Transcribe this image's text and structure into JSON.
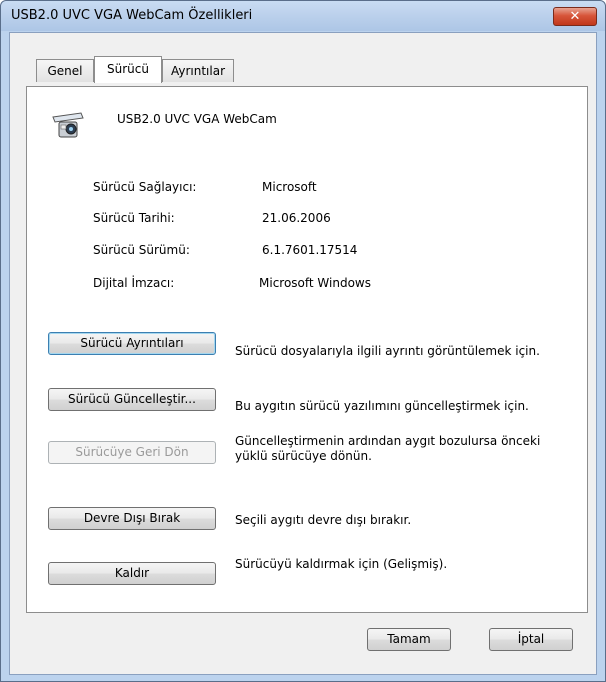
{
  "window": {
    "title": "USB2.0 UVC VGA WebCam Özellikleri",
    "close_label": "✕"
  },
  "tabs": [
    {
      "label": "Genel"
    },
    {
      "label": "Sürücü"
    },
    {
      "label": "Ayrıntılar"
    }
  ],
  "device": {
    "name": "USB2.0 UVC VGA WebCam",
    "icon": "webcam-icon"
  },
  "info": [
    {
      "label": "Sürücü Sağlayıcı:",
      "value": "Microsoft"
    },
    {
      "label": "Sürücü Tarihi:",
      "value": "21.06.2006"
    },
    {
      "label": "Sürücü Sürümü:",
      "value": "6.1.7601.17514"
    },
    {
      "label": "Dijital İmzacı:",
      "value": "Microsoft Windows"
    }
  ],
  "actions": [
    {
      "button": "Sürücü Ayrıntıları",
      "description": "Sürücü dosyalarıyla ilgili ayrıntı görüntülemek için."
    },
    {
      "button": "Sürücü Güncelleştir...",
      "description": "Bu aygıtın sürücü yazılımını güncelleştirmek için."
    },
    {
      "button": "Sürücüye Geri Dön",
      "description_line1": "Güncelleştirmenin ardından aygıt bozulursa önceki",
      "description_line2": "yüklü sürücüye dönün."
    },
    {
      "button": "Devre Dışı Bırak",
      "description": "Seçili aygıtı devre dışı bırakır."
    },
    {
      "button": "Kaldır",
      "description": "Sürücüyü kaldırmak için (Gelişmiş)."
    }
  ],
  "footer": {
    "ok_label": "Tamam",
    "cancel_label": "İptal"
  }
}
